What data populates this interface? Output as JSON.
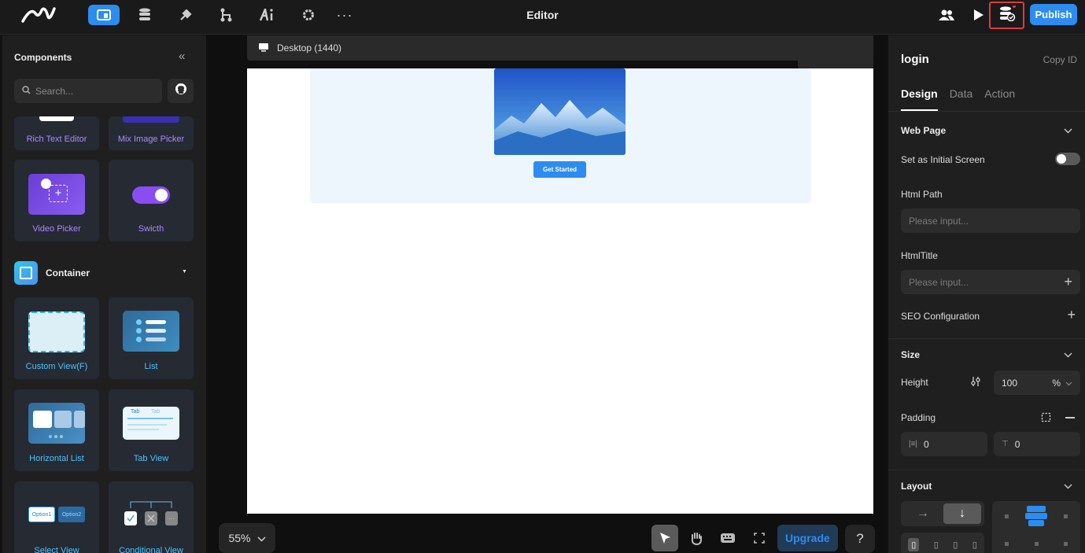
{
  "topbar": {
    "title": "Editor",
    "publish_label": "Publish",
    "icons": [
      "logo-icon",
      "pages-icon",
      "database-icon",
      "plugin-icon",
      "workflow-icon",
      "ai-icon",
      "settings-icon",
      "more-icon",
      "team-icon",
      "preview-play-icon",
      "data-check-icon"
    ]
  },
  "left_panel": {
    "title": "Components",
    "search_placeholder": "Search...",
    "cards_top": [
      {
        "label": "Rich Text Editor"
      },
      {
        "label": "Mix Image Picker"
      },
      {
        "label": "Video Picker"
      },
      {
        "label": "Swicth"
      }
    ],
    "section_title": "Container",
    "container_cards": [
      {
        "label": "Custom View(F)"
      },
      {
        "label": "List"
      },
      {
        "label": "Horizontal List"
      },
      {
        "label": "Tab View"
      },
      {
        "label": "Select View"
      },
      {
        "label": "Conditional View"
      }
    ],
    "tab_thumb": [
      "Tab",
      "Tab"
    ],
    "option_thumb": [
      "Option1",
      "Option2"
    ]
  },
  "canvas": {
    "device_label": "Desktop (1440)",
    "hero_button": "Get Started",
    "zoom": "55%",
    "upgrade_label": "Upgrade",
    "help_label": "?"
  },
  "right_panel": {
    "page_name": "login",
    "copy_id": "Copy ID",
    "tabs": [
      "Design",
      "Data",
      "Action"
    ],
    "web_page": {
      "title": "Web Page",
      "initial_screen_label": "Set as Initial Screen",
      "html_path_label": "Html Path",
      "html_path_placeholder": "Please input...",
      "html_title_label": "HtmlTitle",
      "html_title_placeholder": "Please input...",
      "seo_label": "SEO Configuration"
    },
    "size": {
      "title": "Size",
      "height_label": "Height",
      "height_value": "100",
      "height_unit": "%",
      "padding_label": "Padding",
      "padding_left": "0",
      "padding_top": "0"
    },
    "layout": {
      "title": "Layout"
    }
  },
  "colors": {
    "accent": "#2d8cf0",
    "highlight": "#e0393e"
  }
}
